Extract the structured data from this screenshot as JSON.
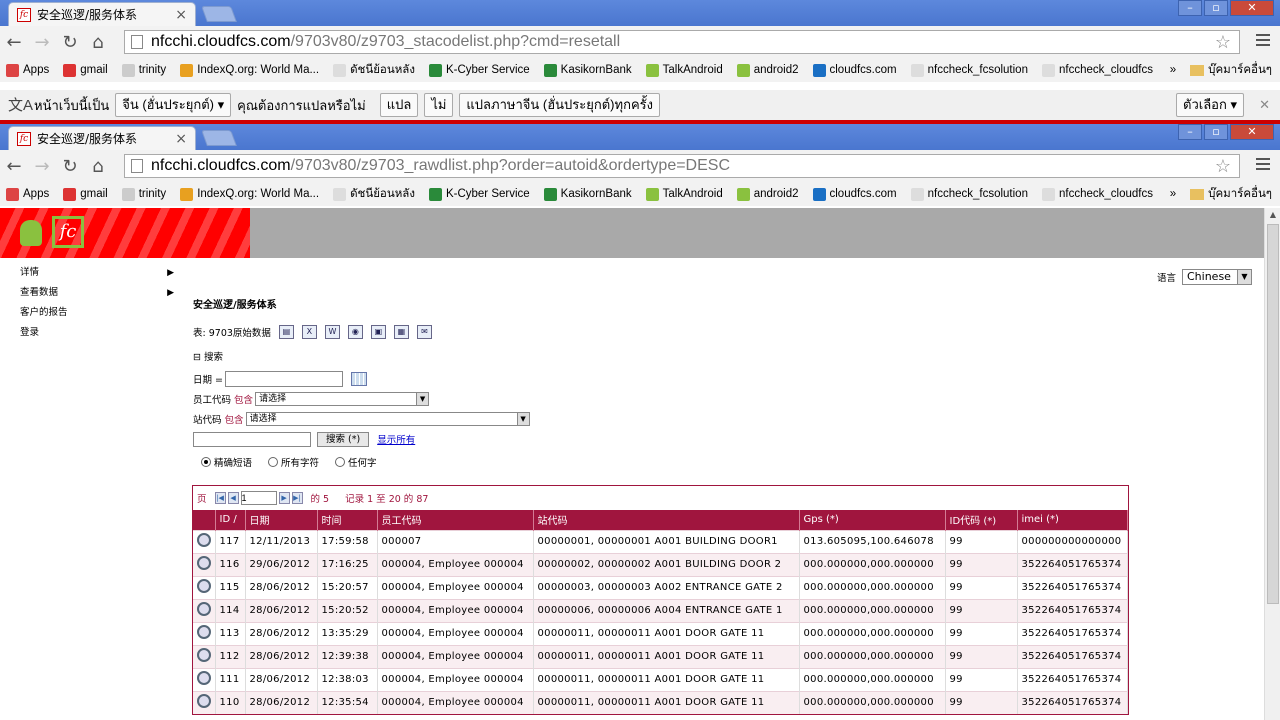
{
  "window1": {
    "tab_title": "安全巡逻/服务体系",
    "url_host": "nfcchi.cloudfcs.com",
    "url_path": "/9703v80/z9703_stacodelist.php?cmd=resetall"
  },
  "window2": {
    "tab_title": "安全巡逻/服务体系",
    "url_host": "nfcchi.cloudfcs.com",
    "url_path": "/9703v80/z9703_rawdlist.php?order=autoid&ordertype=DESC"
  },
  "tab_close": "×",
  "window_buttons": [
    "–",
    "▫",
    "✕"
  ],
  "nav": {
    "back": "←",
    "forward": "→",
    "reload": "↻",
    "home": "⌂",
    "star": "☆"
  },
  "bookmarks": [
    {
      "label": "Apps",
      "color": "#d44"
    },
    {
      "label": "gmail",
      "color": "#d33"
    },
    {
      "label": "trinity",
      "color": "#ccc"
    },
    {
      "label": "IndexQ.org: World Ma...",
      "color": "#e8a020"
    },
    {
      "label": "ดัชนีย้อนหลัง",
      "color": "#ddd"
    },
    {
      "label": "K-Cyber Service",
      "color": "#2a8a3a"
    },
    {
      "label": "KasikornBank",
      "color": "#2a8a3a"
    },
    {
      "label": "TalkAndroid",
      "color": "#8ac13f"
    },
    {
      "label": "android2",
      "color": "#8ac13f"
    },
    {
      "label": "cloudfcs.com",
      "color": "#1a6fc4"
    },
    {
      "label": "nfccheck_fcsolution",
      "color": "#ddd"
    },
    {
      "label": "nfccheck_cloudfcs",
      "color": "#ddd"
    }
  ],
  "bookmarks_more": "»",
  "bookmarks_other": "บุ๊คมาร์คอื่นๆ",
  "translate_bar": {
    "icon": "文A",
    "prefix": "หน้าเว็บนี้เป็น",
    "language": "จีน (ฮั่นประยุกต์)",
    "question": "คุณต้องการแปลหรือไม่",
    "translate": "แปล",
    "no": "ไม่",
    "always": "แปลภาษาจีน (ฮั่นประยุกต์)ทุกครั้ง",
    "options": "ตัวเลือก",
    "close": "✕"
  },
  "sidebar": [
    {
      "label": "详情",
      "arrow": "▶"
    },
    {
      "label": "查看数据",
      "arrow": "▶"
    },
    {
      "label": "客户的报告",
      "arrow": ""
    },
    {
      "label": "登录",
      "arrow": ""
    }
  ],
  "language": {
    "label": "语言",
    "value": "Chinese"
  },
  "page": {
    "heading": "安全巡逻/服务体系",
    "table_label": "表:",
    "table_name": "9703原始数据",
    "search_toggle": "⊟ 搜索",
    "date_label": "日期 =",
    "emp_label": "员工代码",
    "contains": "包含",
    "station_label": "站代码",
    "please_select": "请选择",
    "search_btn": "搜索 (*)",
    "show_all": "显示所有",
    "radio_exact": "精确短语",
    "radio_all": "所有字符",
    "radio_any": "任何字"
  },
  "pager": {
    "page_label": "页",
    "page_value": "1",
    "of": "的 5",
    "records": "记录 1 至 20 的 87"
  },
  "columns": [
    "ID",
    "日期",
    "时间",
    "员工代码",
    "站代码",
    "Gps (*)",
    "ID代码 (*)",
    "imei (*)"
  ],
  "sort_marker": "/",
  "rows": [
    [
      "117",
      "12/11/2013",
      "17:59:58",
      "000007",
      "00000001, 00000001 A001 BUILDING DOOR1",
      "013.605095,100.646078",
      "99",
      "000000000000000"
    ],
    [
      "116",
      "29/06/2012",
      "17:16:25",
      "000004, Employee 000004",
      "00000002, 00000002 A001 BUILDING DOOR 2",
      "000.000000,000.000000",
      "99",
      "352264051765374"
    ],
    [
      "115",
      "28/06/2012",
      "15:20:57",
      "000004, Employee 000004",
      "00000003, 00000003 A002 ENTRANCE GATE 2",
      "000.000000,000.000000",
      "99",
      "352264051765374"
    ],
    [
      "114",
      "28/06/2012",
      "15:20:52",
      "000004, Employee 000004",
      "00000006, 00000006 A004 ENTRANCE GATE 1",
      "000.000000,000.000000",
      "99",
      "352264051765374"
    ],
    [
      "113",
      "28/06/2012",
      "13:35:29",
      "000004, Employee 000004",
      "00000011, 00000011 A001 DOOR GATE 11",
      "000.000000,000.000000",
      "99",
      "352264051765374"
    ],
    [
      "112",
      "28/06/2012",
      "12:39:38",
      "000004, Employee 000004",
      "00000011, 00000011 A001 DOOR GATE 11",
      "000.000000,000.000000",
      "99",
      "352264051765374"
    ],
    [
      "111",
      "28/06/2012",
      "12:38:03",
      "000004, Employee 000004",
      "00000011, 00000011 A001 DOOR GATE 11",
      "000.000000,000.000000",
      "99",
      "352264051765374"
    ],
    [
      "110",
      "28/06/2012",
      "12:35:54",
      "000004, Employee 000004",
      "00000011, 00000011 A001 DOOR GATE 11",
      "000.000000,000.000000",
      "99",
      "352264051765374"
    ]
  ]
}
